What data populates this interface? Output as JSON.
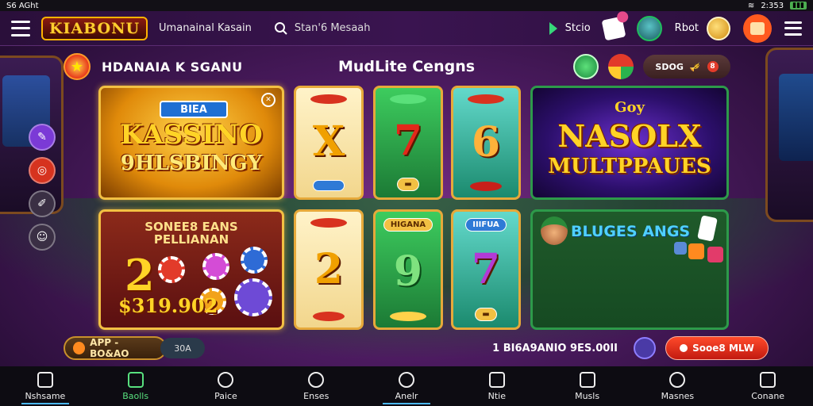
{
  "status_bar": {
    "left": "S6 AGht",
    "right": "2:353"
  },
  "app_bar": {
    "logo": "KIABONU",
    "subtitle": "Umanainal Kasain",
    "search_text": "Stan'6 Mesaah",
    "item1": "Stcio",
    "item2": "Rbot"
  },
  "section": {
    "left_title": "HDANAIA K SGANU",
    "center_title": "MudLite Cengns",
    "pill_label": "SDOG",
    "pill_badge": "8"
  },
  "tiles": {
    "t1": {
      "badge": "BIEA",
      "line1": "KASSINO",
      "line2": "9HLSBINGY"
    },
    "t5": {
      "top": "Goy",
      "line1": "NASOLX",
      "line2": "MULTPPAUES"
    },
    "t6": {
      "head1": "SONEE8 EANS",
      "head2": "PELLIANAN",
      "number": "2",
      "amount": "$319.902"
    },
    "t10": {
      "title": "BLUGES ANGS"
    },
    "reels": [
      {
        "top_label": "",
        "symbol": "X",
        "bottom_label": ""
      },
      {
        "top_label": "",
        "symbol": "7",
        "bottom_label": ""
      },
      {
        "top_label": "",
        "symbol": "6",
        "bottom_label": ""
      },
      {
        "top_label": "",
        "symbol": "2",
        "bottom_label": ""
      },
      {
        "top_label": "HIGANA",
        "symbol": "9",
        "bottom_label": ""
      },
      {
        "top_label": "IIIFUA",
        "symbol": "7",
        "bottom_label": ""
      }
    ]
  },
  "ticker": {
    "app_label": "APP - BO&AO",
    "stack_label": "30A",
    "text": "1 BI6A9ANIO 9ES.00II",
    "cta": "Sooe8 MLW"
  },
  "bottom_nav": [
    {
      "label": "Nshsame",
      "icon": "home-icon"
    },
    {
      "label": "Baolls",
      "icon": "home-outline-icon"
    },
    {
      "label": "Paice",
      "icon": "chip-icon"
    },
    {
      "label": "Enses",
      "icon": "compass-icon"
    },
    {
      "label": "Anelr",
      "icon": "search-icon"
    },
    {
      "label": "Ntie",
      "icon": "house-icon"
    },
    {
      "label": "Musls",
      "icon": "bag-icon"
    },
    {
      "label": "Masnes",
      "icon": "gear-icon"
    },
    {
      "label": "Conane",
      "icon": "grid-icon"
    }
  ],
  "colors": {
    "accent": "#ffcf2e",
    "active_nav": "#58e07e",
    "cta": "#e0301c"
  }
}
